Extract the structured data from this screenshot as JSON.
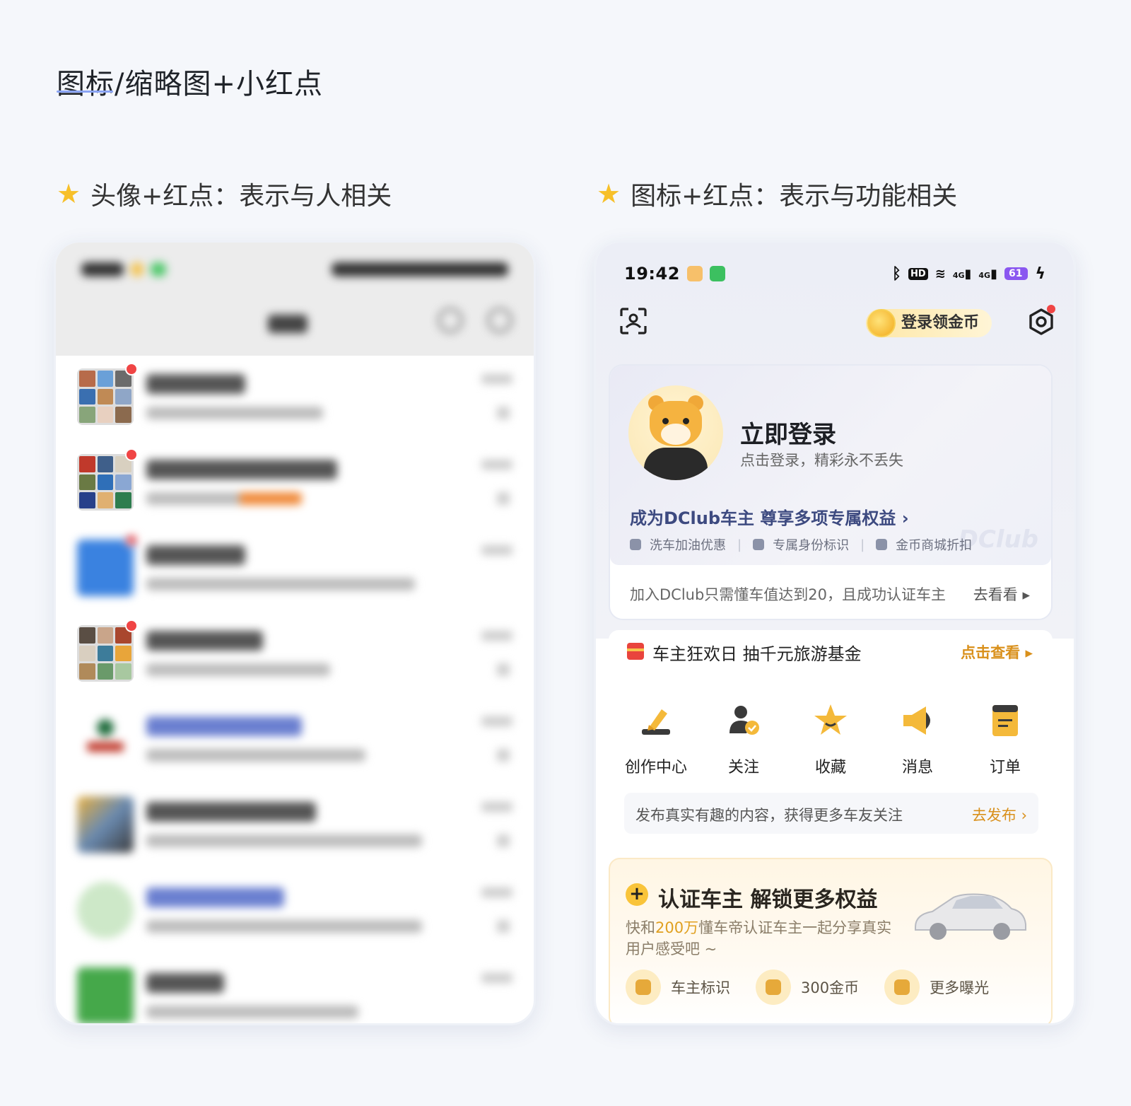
{
  "page": {
    "title": "图标/缩略图+小红点"
  },
  "headings": {
    "left": "头像+红点：表示与人相关",
    "right": "图标+红点：表示与功能相关",
    "star_icon": "star-icon"
  },
  "right_phone": {
    "status": {
      "time": "19:42",
      "hd": "HD",
      "network1": "4G",
      "network2": "4G",
      "battery": "61"
    },
    "header": {
      "coin_label": "登录领金币"
    },
    "login": {
      "title": "立即登录",
      "subtitle": "点击登录，精彩永不丢失",
      "dclub_line": "成为DClub车主 尊享多项专属权益 ›",
      "benefits": [
        "洗车加油优惠",
        "专属身份标识",
        "金币商城折扣"
      ],
      "watermark": "DClub",
      "join_text": "加入DClub只需懂车值达到20，且成功认证车主",
      "join_link": "去看看 ▸"
    },
    "festival": {
      "text": "车主狂欢日 抽千元旅游基金",
      "link": "点击查看 ▸"
    },
    "functions": {
      "items": [
        {
          "label": "创作中心",
          "icon": "pen-icon"
        },
        {
          "label": "关注",
          "icon": "follow-user-icon"
        },
        {
          "label": "收藏",
          "icon": "star-icon"
        },
        {
          "label": "消息",
          "icon": "megaphone-icon"
        },
        {
          "label": "订单",
          "icon": "order-icon"
        }
      ],
      "publish_text": "发布真实有趣的内容，获得更多车友关注",
      "publish_link": "去发布 ›"
    },
    "certify": {
      "title": "认证车主 解锁更多权益",
      "desc_prefix": "快和",
      "desc_highlight": "200万",
      "desc_suffix": "懂车帝认证车主一起分享真实用户感受吧 ~",
      "items": [
        "车主标识",
        "300金币",
        "更多曝光"
      ]
    }
  },
  "colors": {
    "red_dot": "#f04545",
    "accent_gold": "#d9901b",
    "dclub_blue": "#3d4a80"
  }
}
